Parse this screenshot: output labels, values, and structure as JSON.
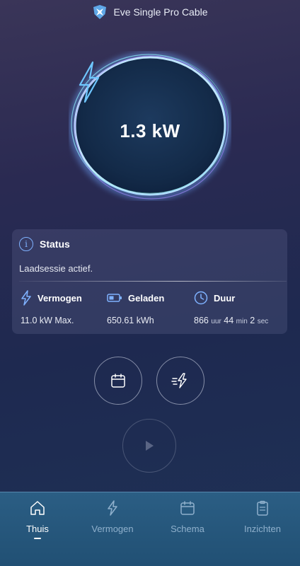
{
  "header": {
    "title": "Eve Single Pro Cable",
    "logo_icon": "eve-shield-icon"
  },
  "power": {
    "value": "1.3 kW",
    "icon": "bolt-icon"
  },
  "status": {
    "title": "Status",
    "message": "Laadsessie actief.",
    "metrics": [
      {
        "label": "Vermogen",
        "icon": "bolt-outline-icon",
        "value": "11.0 kW Max."
      },
      {
        "label": "Geladen",
        "icon": "battery-icon",
        "value": "650.61 kWh"
      },
      {
        "label": "Duur",
        "icon": "clock-icon",
        "hours": "866",
        "hours_unit": "uur",
        "minutes": "44",
        "minutes_unit": "min",
        "seconds": "2",
        "seconds_unit": "sec"
      }
    ]
  },
  "actions": {
    "schedule_icon": "calendar-icon",
    "boost_icon": "fast-charge-icon",
    "play_icon": "play-icon"
  },
  "tabs": [
    {
      "label": "Thuis",
      "icon": "home-icon",
      "active": true
    },
    {
      "label": "Vermogen",
      "icon": "bolt-outline-icon",
      "active": false
    },
    {
      "label": "Schema",
      "icon": "calendar-icon",
      "active": false
    },
    {
      "label": "Inzichten",
      "icon": "clipboard-icon",
      "active": false
    }
  ],
  "colors": {
    "accent": "#7fb2ff",
    "tabbar": "#2b5e84",
    "inactive_tab": "#8fb0cc"
  }
}
